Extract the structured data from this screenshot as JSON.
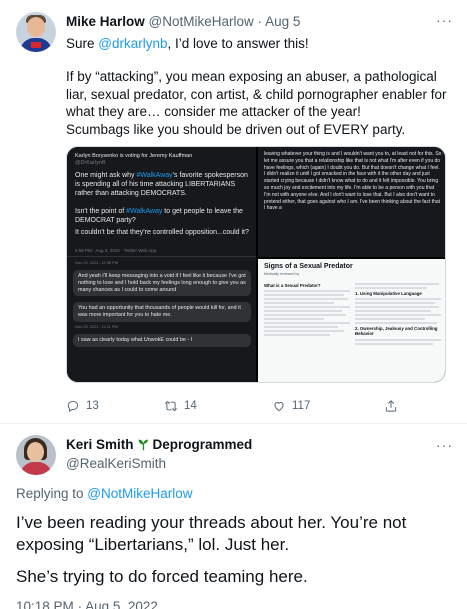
{
  "parent_tweet": {
    "author_name": "Mike Harlow",
    "handle": "@NotMikeHarlow",
    "separator": "·",
    "date": "Aug 5",
    "line1_prefix": "Sure ",
    "line1_mention": "@drkarlynb",
    "line1_suffix": ", I’d love to answer this!",
    "paragraph2": "If by “attacking”, you mean exposing an abuser, a pathological liar, sexual predator, con artist, & child pornographer enabler for what they are… consider me attacker of the year!",
    "paragraph3": "Scumbags like you should be driven out of EVERY party.",
    "actions": {
      "replies": "13",
      "retweets": "14",
      "likes": "117"
    }
  },
  "media": {
    "quoted": {
      "name_line": "Karlyn Borysenko is voting for Jeremy Kauffman",
      "handle": "@DrKarlynB",
      "text1_a": "One might ask why ",
      "text1_tag": "#WalkAway",
      "text1_b": "'s favorite spokesperson is spending all of his time attacking LIBERTARIANS rather than attacking DEMOCRATS.",
      "text2_a": "Isn't the point of ",
      "text2_tag": "#WalkAway",
      "text2_b": " to get people to leave the DEMOCRAT party?",
      "text3": "It couldn't be that they're controlled opposition...could it?",
      "meta": "6:58 PM · Aug 4, 2022 · Twitter Web App"
    },
    "dms": [
      {
        "text": "Nov 25, 2021, 12:38 PM",
        "is_time": true
      },
      {
        "text": "And yeah I'll keep messaging into a void if I feel like it because I've got nothing to lose and I hold back my feelings long enough to give you as many chances as I could to come around",
        "is_time": false
      },
      {
        "text": "You had an opportunity that thousands of people would kill for, and it was more important for you to hate me.",
        "is_time": false
      },
      {
        "text": "Nov 25, 2021, 11:31 PM",
        "is_time": true
      },
      {
        "text": "I saw as clearly today what UnwokE could be - I",
        "is_time": false
      }
    ],
    "right_top_text": "leaving whatever your thing is and I wouldn't want you to, at least not for this. So let me assure you that a relationship like that is not what I'm after even if you do have feelings, which (again) I doubt you do. But that doesn't change what I feel. I didn't realize it until I got smacked in the face with it the other day and just started crying because I didn't know what to do and it felt impossible. You bring so much joy and excitement into my life. I'm able to be a person with you that I'm not with anyone else. And I don't want to lose that. But I also don't want to pretend either, that goes against who I am. I've been thinking about the fact that I have a",
    "doc": {
      "title": "Signs of a Sexual Predator",
      "byline": "Medically reviewed by",
      "col1_heading": "What is a Sexual Predator?",
      "col2_heading1": "1. Using Manipulative Language",
      "col2_heading2": "2. Ownership, Jealousy and Controlling Behavior"
    }
  },
  "reply": {
    "author_name": "Keri Smith",
    "badge_icon": "sprout-icon",
    "badge_text": "Deprogrammed",
    "handle": "@RealKeriSmith",
    "replying_prefix": "Replying to ",
    "replying_handle": "@NotMikeHarlow",
    "paragraph1": "I’ve been reading your threads about her. You’re not exposing “Libertarians,” lol. Just her.",
    "paragraph2": "She’s trying to do forced teaming here.",
    "time": "10:18 PM",
    "separator": "·",
    "date": "Aug 5, 2022"
  },
  "colors": {
    "link": "#1d9bf0",
    "muted": "#536471",
    "text": "#0f1419",
    "badge_green": "#1a8917"
  }
}
